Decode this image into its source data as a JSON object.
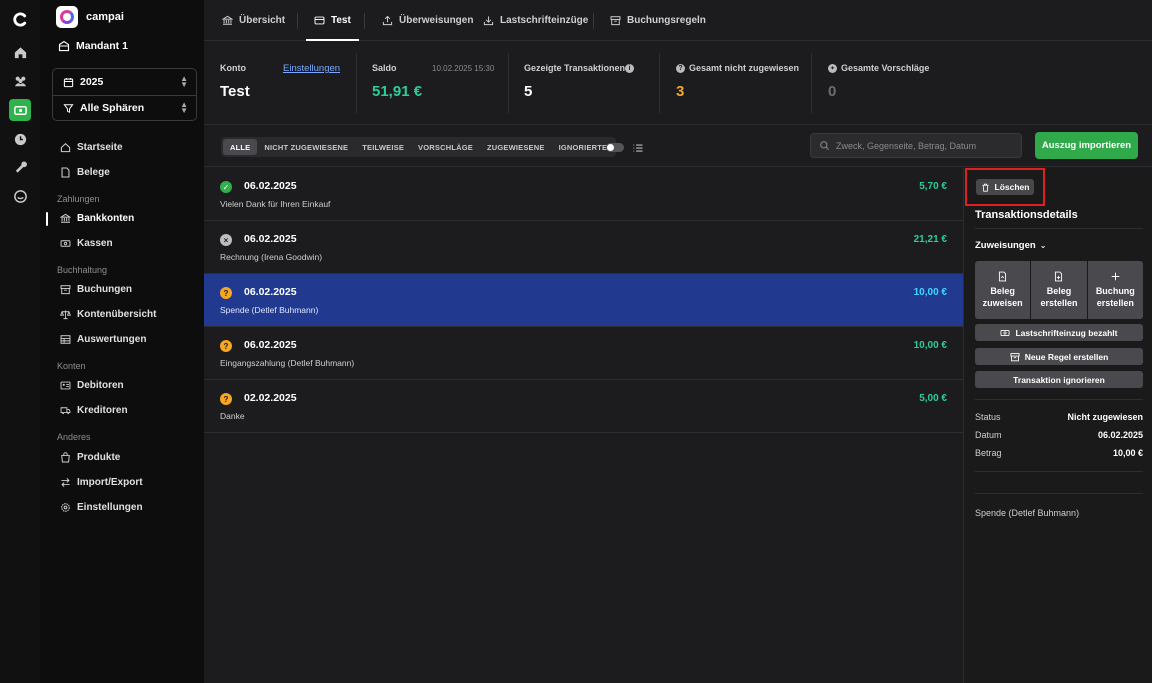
{
  "app": {
    "name": "campai",
    "mandant": "Mandant 1",
    "year": "2025",
    "sphere": "Alle Sphären"
  },
  "rail": {
    "icons": [
      "logo-icon",
      "home-icon",
      "members-icon",
      "bank-icon",
      "clock-icon",
      "wrench-icon",
      "chat-icon"
    ],
    "active": "bank-icon"
  },
  "sidebar": {
    "items": [
      {
        "label": "Startseite",
        "icon": "home-icon"
      },
      {
        "label": "Belege",
        "icon": "document-icon"
      }
    ],
    "sections": [
      {
        "title": "Zahlungen",
        "items": [
          {
            "label": "Bankkonten",
            "active": true
          },
          {
            "label": "Kassen"
          }
        ]
      },
      {
        "title": "Buchhaltung",
        "items": [
          {
            "label": "Buchungen"
          },
          {
            "label": "Kontenübersicht"
          },
          {
            "label": "Auswertungen"
          }
        ]
      },
      {
        "title": "Konten",
        "items": [
          {
            "label": "Debitoren"
          },
          {
            "label": "Kreditoren"
          }
        ]
      },
      {
        "title": "Anderes",
        "items": [
          {
            "label": "Produkte"
          },
          {
            "label": "Import/Export"
          },
          {
            "label": "Einstellungen"
          }
        ]
      }
    ]
  },
  "tabs": [
    {
      "label": "Übersicht"
    },
    {
      "label": "Test",
      "active": true
    },
    {
      "label": "Überweisungen"
    },
    {
      "label": "Lastschrifteinzüge"
    },
    {
      "label": "Buchungsregeln"
    }
  ],
  "summary": {
    "konto_label": "Konto",
    "konto_link": "Einstellungen",
    "konto_value": "Test",
    "saldo_label": "Saldo",
    "saldo_timestamp": "10.02.2025 15:30",
    "saldo_value": "51,91 €",
    "gezeigt_label": "Gezeigte Transaktionen",
    "gezeigt_value": "5",
    "nicht_label": "Gesamt nicht zugewiesen",
    "nicht_value": "3",
    "vorschlaege_label": "Gesamte Vorschläge",
    "vorschlaege_value": "0"
  },
  "colors": {
    "accent_green": "#2fa94a",
    "saldo": "#2ecc9a",
    "warning": "#f5a623",
    "selected_row": "#213a8f",
    "highlight": "#e02020"
  },
  "filters": [
    "ALLE",
    "NICHT ZUGEWIESENE",
    "TEILWEISE",
    "VORSCHLÄGE",
    "ZUGEWIESENE",
    "IGNORIERTE"
  ],
  "search": {
    "placeholder": "Zweck, Gegenseite, Betrag, Datum",
    "value": ""
  },
  "import_label": "Auszug importieren",
  "transactions": [
    {
      "date": "06.02.2025",
      "description": "Vielen Dank für Ihren Einkauf",
      "amount": "5,70 €",
      "status": "assigned"
    },
    {
      "date": "06.02.2025",
      "description": "Rechnung (Irena Goodwin)",
      "amount": "21,21 €",
      "status": "ignored"
    },
    {
      "date": "06.02.2025",
      "description": "Spende (Detlef Buhmann)",
      "amount": "10,00 €",
      "status": "unassigned",
      "selected": true
    },
    {
      "date": "06.02.2025",
      "description": "Eingangszahlung (Detlef Buhmann)",
      "amount": "10,00 €",
      "status": "unassigned"
    },
    {
      "date": "02.02.2025",
      "description": "Danke",
      "amount": "5,00 €",
      "status": "unassigned"
    }
  ],
  "panel": {
    "delete_label": "Löschen",
    "title": "Transaktionsdetails",
    "zuweisungen_label": "Zuweisungen",
    "actions": [
      {
        "line1": "Beleg",
        "line2": "zuweisen"
      },
      {
        "line1": "Beleg",
        "line2": "erstellen"
      },
      {
        "line1": "Buchung",
        "line2": "erstellen"
      }
    ],
    "lastschrift_label": "Lastschrifteinzug bezahlt",
    "regel_label": "Neue Regel erstellen",
    "ignore_label": "Transaktion ignorieren",
    "status_label": "Status",
    "status_value": "Nicht zugewiesen",
    "datum_label": "Datum",
    "datum_value": "06.02.2025",
    "betrag_label": "Betrag",
    "betrag_value": "10,00 €",
    "note": "Spende (Detlef Buhmann)"
  }
}
